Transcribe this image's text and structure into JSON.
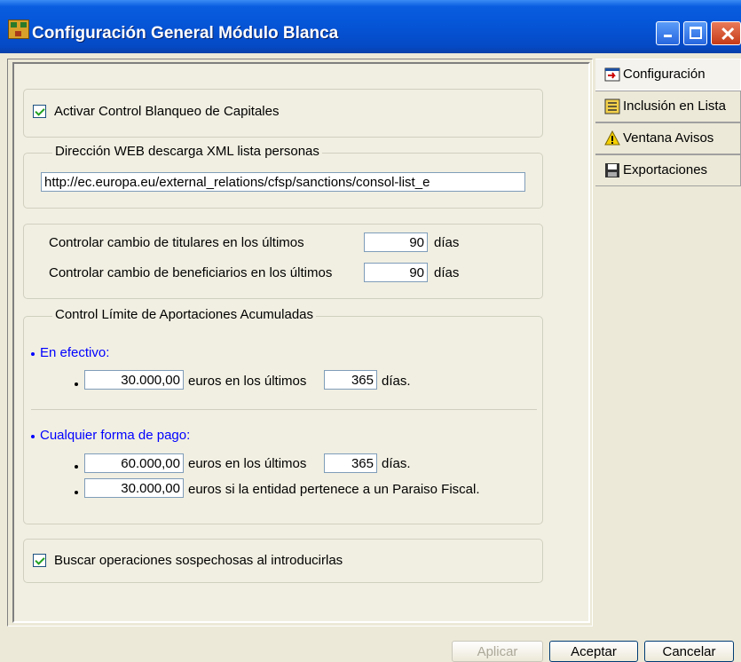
{
  "window": {
    "title": "Configuración General Módulo Blanca"
  },
  "tabs": [
    {
      "label": "Configuración",
      "icon": "config-icon"
    },
    {
      "label": "Inclusión en Lista",
      "icon": "list-icon"
    },
    {
      "label": "Ventana Avisos",
      "icon": "warning-icon"
    },
    {
      "label": "Exportaciones",
      "icon": "save-icon"
    }
  ],
  "config": {
    "activar_label": "Activar Control Blanqueo de Capitales",
    "activar_checked": true,
    "web_group_label": "Dirección WEB descarga XML lista personas",
    "web_url": "http://ec.europa.eu/external_relations/cfsp/sanctions/consol-list_e",
    "titulares_label": "Controlar cambio de titulares en los últimos",
    "titulares_value": "90",
    "beneficiarios_label": "Controlar cambio de beneficiarios en los últimos",
    "beneficiarios_value": "90",
    "dias": "días",
    "limite_group_label": "Control Límite de Aportaciones Acumuladas",
    "efectivo_label": "En efectivo:",
    "efectivo_amount": "30.000,00",
    "efectivo_text": "euros en los últimos",
    "efectivo_days": "365",
    "dias_punto": "días.",
    "cualquier_label": "Cualquier forma de pago:",
    "cualquier_amount": "60.000,00",
    "cualquier_text": "euros en los últimos",
    "cualquier_days": "365",
    "paraiso_amount": "30.000,00",
    "paraiso_text": "euros si la entidad pertenece a un Paraiso Fiscal.",
    "buscar_label": "Buscar operaciones sospechosas al introducirlas",
    "buscar_checked": true
  },
  "buttons": {
    "aplicar": "Aplicar",
    "aceptar": "Aceptar",
    "cancelar": "Cancelar"
  }
}
